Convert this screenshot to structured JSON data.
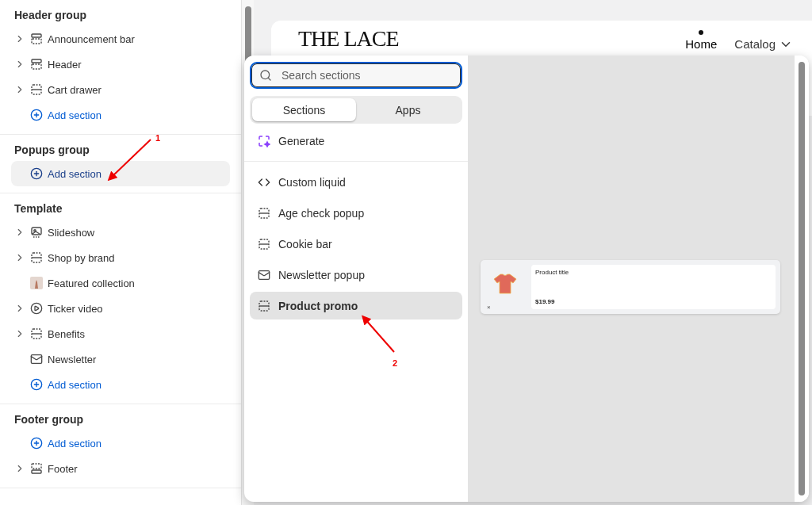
{
  "sidebar": {
    "groups": [
      {
        "title": "Header group",
        "entries": [
          {
            "kind": "section",
            "label": "Announcement bar",
            "expandable": true
          },
          {
            "kind": "section",
            "label": "Header",
            "expandable": true
          },
          {
            "kind": "section",
            "label": "Cart drawer",
            "expandable": true
          },
          {
            "kind": "add",
            "label": "Add section",
            "selected": false
          }
        ]
      },
      {
        "title": "Popups group",
        "entries": [
          {
            "kind": "add",
            "label": "Add section",
            "selected": true
          }
        ]
      },
      {
        "title": "Template",
        "entries": [
          {
            "kind": "section",
            "label": "Slideshow",
            "expandable": true
          },
          {
            "kind": "section",
            "label": "Shop by brand",
            "expandable": true
          },
          {
            "kind": "section",
            "label": "Featured collection",
            "expandable": false
          },
          {
            "kind": "section",
            "label": "Ticker video",
            "expandable": true
          },
          {
            "kind": "section",
            "label": "Benefits",
            "expandable": true
          },
          {
            "kind": "section",
            "label": "Newsletter",
            "expandable": false
          },
          {
            "kind": "add",
            "label": "Add section",
            "selected": false
          }
        ]
      },
      {
        "title": "Footer group",
        "entries": [
          {
            "kind": "add",
            "label": "Add section",
            "selected": false
          },
          {
            "kind": "section",
            "label": "Footer",
            "expandable": true
          }
        ]
      }
    ]
  },
  "store": {
    "logo": "THE LACE",
    "nav": [
      {
        "label": "Home",
        "selected": true
      },
      {
        "label": "Catalog",
        "selected": false
      }
    ]
  },
  "picker": {
    "search": {
      "placeholder": "Search sections"
    },
    "tabs": [
      {
        "label": "Sections",
        "selected": true
      },
      {
        "label": "Apps",
        "selected": false
      }
    ],
    "generate": "Generate",
    "items": [
      {
        "label": "Custom liquid",
        "selected": false
      },
      {
        "label": "Age check popup",
        "selected": false
      },
      {
        "label": "Cookie bar",
        "selected": false
      },
      {
        "label": "Newsletter popup",
        "selected": false
      },
      {
        "label": "Product promo",
        "selected": true
      }
    ],
    "preview": {
      "title": "Product title",
      "price": "$19.99",
      "close": "×"
    }
  },
  "annotations": [
    {
      "label": "1"
    },
    {
      "label": "2"
    }
  ]
}
